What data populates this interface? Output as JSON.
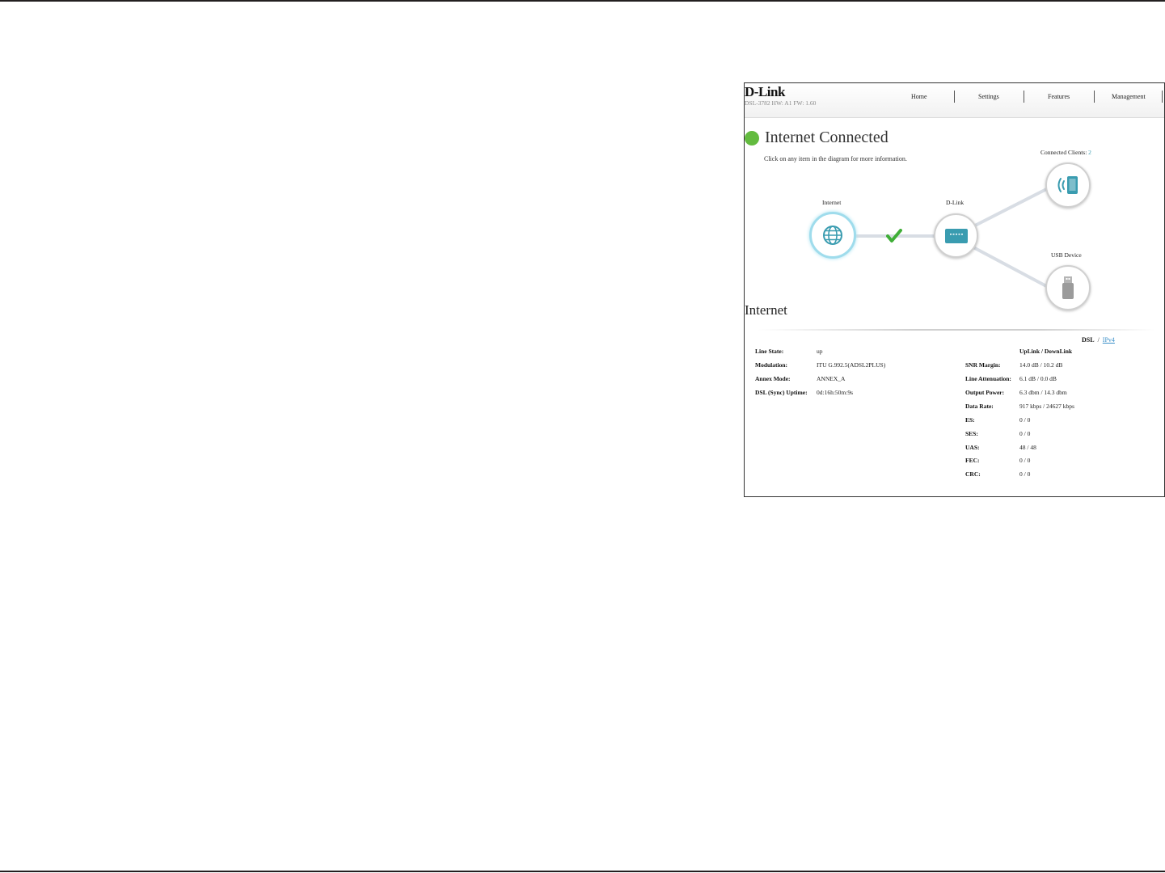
{
  "header": {
    "logo": "D-Link",
    "model_info": "DSL-3782  HW: A1  FW: 1.60",
    "nav": [
      "Home",
      "Settings",
      "Features",
      "Management"
    ]
  },
  "status": {
    "title": "Internet Connected",
    "hint": "Click on any item in the diagram for more information.",
    "color": "#63bb3f"
  },
  "diagram": {
    "internet_label": "Internet",
    "router_label": "D-Link",
    "clients_label": "Connected Clients:",
    "clients_count": "2",
    "usb_label": "USB Device",
    "icons": [
      "globe-icon",
      "router-icon",
      "wireless-device-icon",
      "usb-drive-icon",
      "checkmark-icon"
    ],
    "accent_color": "#3a9cb0"
  },
  "section": {
    "title": "Internet",
    "tab_dsl": "DSL",
    "tab_sep": "/",
    "tab_ipv4": "IPv4"
  },
  "left_info": [
    {
      "label": "Line State:",
      "value": "up"
    },
    {
      "label": "Modulation:",
      "value": "ITU G.992.5(ADSL2PLUS)"
    },
    {
      "label": "Annex Mode:",
      "value": "ANNEX_A"
    },
    {
      "label": "DSL (Sync) Uptime:",
      "value": "0d:16h:50m:9s"
    }
  ],
  "right_info": {
    "header": "UpLink / DownLink",
    "rows": [
      {
        "label": "SNR Margin:",
        "value": "14.0 dB / 10.2 dB"
      },
      {
        "label": "Line Attenuation:",
        "value": "6.1 dB / 0.0 dB"
      },
      {
        "label": "Output Power:",
        "value": "6.3 dbm / 14.3 dbm"
      },
      {
        "label": "Data Rate:",
        "value": "917 kbps / 24627 kbps"
      },
      {
        "label": "ES:",
        "value": "0 / 0"
      },
      {
        "label": "SES:",
        "value": "0 / 0"
      },
      {
        "label": "UAS:",
        "value": "48 / 48"
      },
      {
        "label": "FEC:",
        "value": "0 / 0"
      },
      {
        "label": "CRC:",
        "value": "0 / 0"
      }
    ]
  }
}
